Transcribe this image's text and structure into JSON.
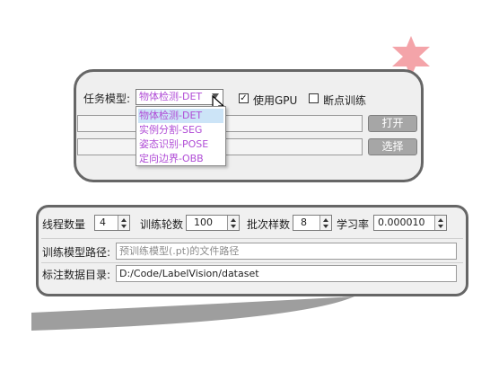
{
  "colors": {
    "accent_purple": "#b04cd6",
    "panel_border": "#666666",
    "star": "#f39aa0"
  },
  "task_panel": {
    "task_label": "任务模型:",
    "task_select": {
      "selected": "物体检测-DET",
      "options": [
        "物体检测-DET",
        "实例分割-SEG",
        "姿态识别-POSE",
        "定向边界-OBB"
      ]
    },
    "use_gpu": {
      "label": "使用GPU",
      "checked": true
    },
    "resume": {
      "label": "断点训练",
      "checked": false
    },
    "open_button": "打开",
    "select_button": "选择"
  },
  "params_panel": {
    "threads": {
      "label": "线程数量",
      "value": "4"
    },
    "epochs": {
      "label": "训练轮数",
      "value": "100"
    },
    "batch": {
      "label": "批次样数",
      "value": "8"
    },
    "lr": {
      "label": "学习率",
      "value": "0.000010"
    },
    "model_path": {
      "label": "训练模型路径:",
      "placeholder": "预训练模型(.pt)的文件路径"
    },
    "dataset_dir": {
      "label": "标注数据目录:",
      "value": "D:/Code/LabelVision/dataset"
    }
  },
  "icons": {
    "star": "star-icon",
    "cursor": "mouse-cursor-icon",
    "dropdown_arrow": "chevron-down-icon"
  }
}
